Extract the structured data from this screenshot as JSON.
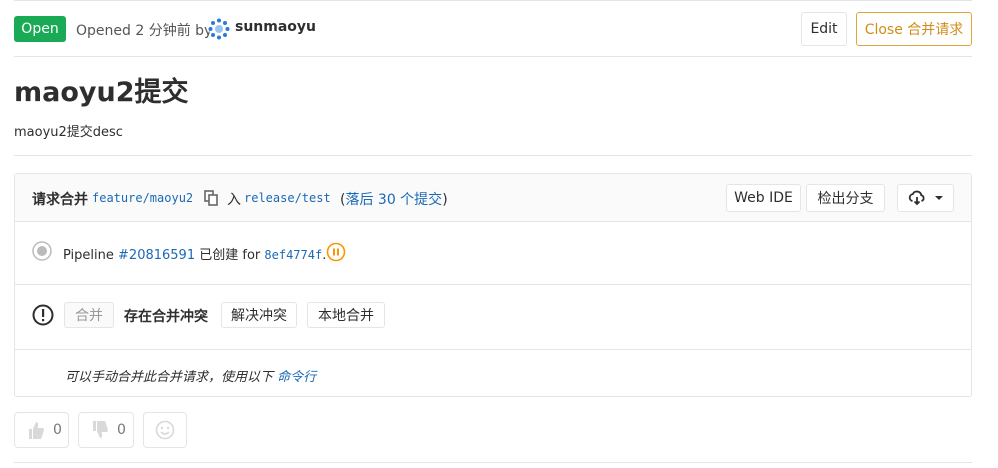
{
  "header": {
    "status": "Open",
    "opened_text": "Opened 2 分钟前 by",
    "author": "sunmaoyu",
    "edit_label": "Edit",
    "close_label": "Close 合并请求"
  },
  "mr": {
    "title": "maoyu2提交",
    "description": "maoyu2提交desc"
  },
  "widget": {
    "request_label": "请求合并",
    "source_branch": "feature/maoyu2",
    "into_label": "入",
    "target_branch": "release/test",
    "behind_open": "(",
    "behind_link": "落后 30 个提交",
    "behind_close": ")",
    "web_ide_label": "Web IDE",
    "checkout_label": "检出分支",
    "pipeline": {
      "prefix": "Pipeline",
      "id": "#20816591",
      "created": "已创建 for",
      "commit": "8ef4774f",
      "suffix": "."
    },
    "merge_label": "合并",
    "conflict_text": "存在合并冲突",
    "resolve_label": "解决冲突",
    "local_merge_label": "本地合并",
    "hint_text": "可以手动合并此合并请求，使用以下",
    "hint_link": "命令行"
  },
  "awards": {
    "thumbs_up_count": "0",
    "thumbs_down_count": "0"
  },
  "colors": {
    "open_badge": "#1aaa55",
    "link": "#1b69b6",
    "close_button": "#d08e19",
    "pipeline_pending": "#fc9403"
  },
  "icons": [
    "avatar",
    "copy-icon",
    "cloud-download-icon",
    "chevron-down-icon",
    "pipeline-status-icon",
    "pause-icon",
    "warning-icon",
    "thumbs-up-icon",
    "thumbs-down-icon",
    "smiley-icon"
  ]
}
